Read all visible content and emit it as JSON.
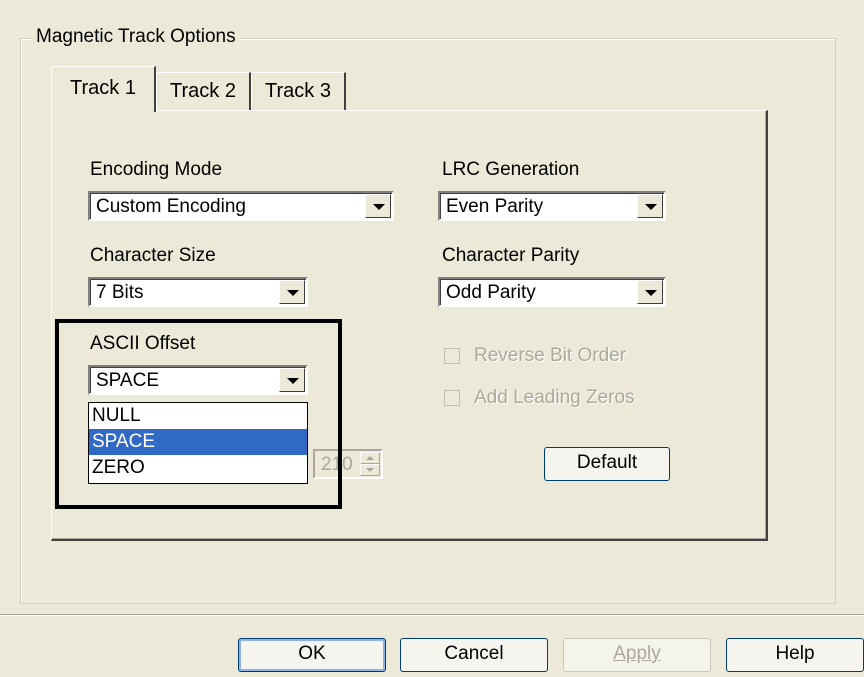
{
  "group": {
    "title": "Magnetic Track Options"
  },
  "tabs": [
    {
      "label": "Track 1"
    },
    {
      "label": "Track 2"
    },
    {
      "label": "Track 3"
    }
  ],
  "encoding_mode": {
    "label": "Encoding Mode",
    "value": "Custom Encoding"
  },
  "lrc_generation": {
    "label": "LRC Generation",
    "value": "Even Parity"
  },
  "character_size": {
    "label": "Character Size",
    "value": "7 Bits"
  },
  "character_parity": {
    "label": "Character Parity",
    "value": "Odd Parity"
  },
  "ascii_offset": {
    "label": "ASCII Offset",
    "value": "SPACE",
    "options": [
      "NULL",
      "SPACE",
      "ZERO"
    ]
  },
  "checkboxes": {
    "reverse_bit_order": "Reverse Bit Order",
    "add_leading_zeros": "Add Leading Zeros"
  },
  "spinner": {
    "value": "210"
  },
  "default_button": "Default",
  "buttons": {
    "ok": "OK",
    "cancel": "Cancel",
    "apply": "Apply",
    "help": "Help"
  },
  "colors": {
    "selection": "#316ac5",
    "dialog_bg": "#ece9d8"
  }
}
